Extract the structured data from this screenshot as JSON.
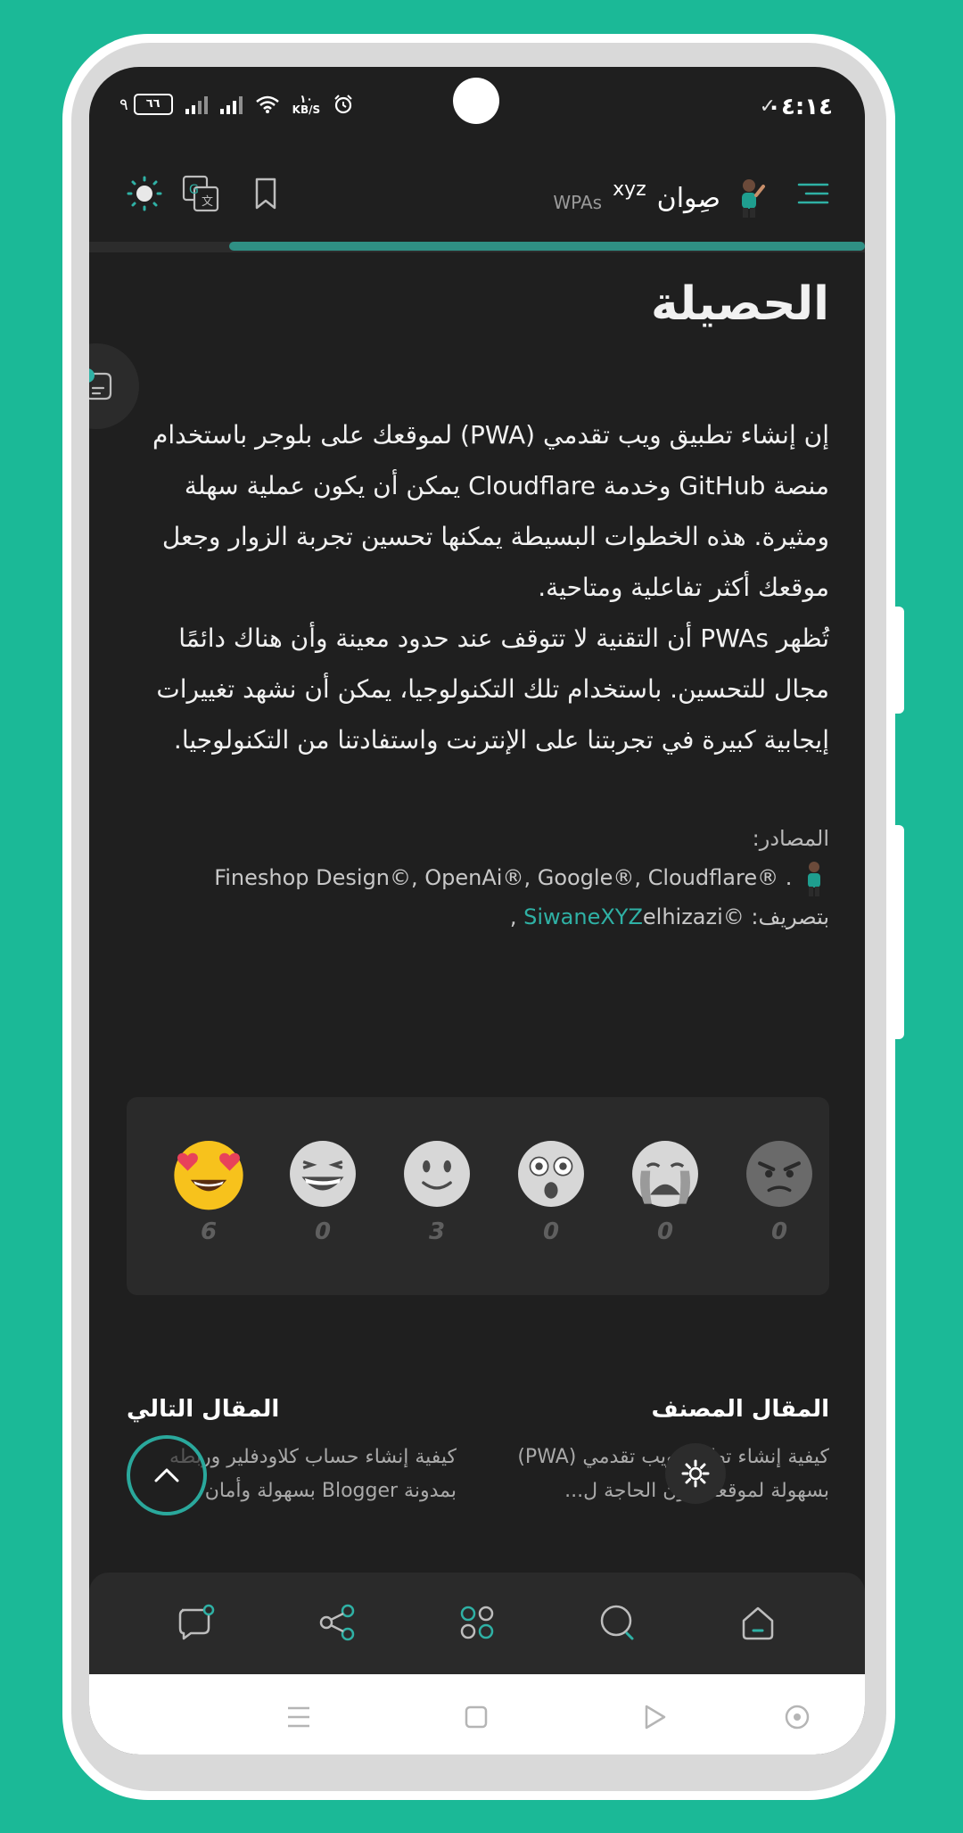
{
  "status_bar": {
    "time": "٠٤:١٤",
    "battery": "٦٦",
    "battery_prefix": "٩",
    "net_speed_value": "١٠",
    "net_speed_unit": "KB/S"
  },
  "header": {
    "brand_name": "صِوان",
    "brand_suffix": "xyz",
    "brand_tag": "WPAs"
  },
  "reading_progress": 0.82,
  "article": {
    "heading": "الحصيلة",
    "paragraph_1": "إن إنشاء تطبيق ويب تقدمي (PWA) لموقعك على بلوجر باستخدام منصة GitHub وخدمة Cloudflare يمكن أن يكون عملية سهلة ومثيرة. هذه الخطوات البسيطة يمكنها تحسين تجربة الزوار وجعل موقعك أكثر تفاعلية ومتاحية.",
    "paragraph_2": "تُظهر PWAs أن التقنية لا تتوقف عند حدود معينة وأن هناك دائمًا مجال للتحسين. باستخدام تلك التكنولوجيا، يمكن أن نشهد تغييرات إيجابية كبيرة في تجربتنا على الإنترنت واستفادتنا من التكنولوجيا.",
    "sources_label": "المصادر:",
    "sources_list": "Fineshop Design©, OpenAi®, Google®, Cloudflare® .",
    "credit_label": "بتصريف: ©",
    "credit_link": "SiwaneXYZ",
    "credit_rest": "elhizazi ,"
  },
  "reactions": [
    {
      "name": "heart-eyes",
      "count": "6"
    },
    {
      "name": "laughing",
      "count": "0"
    },
    {
      "name": "smile",
      "count": "3"
    },
    {
      "name": "surprised",
      "count": "0"
    },
    {
      "name": "crying",
      "count": "0"
    },
    {
      "name": "angry",
      "count": "0"
    }
  ],
  "post_nav": {
    "category_heading": "المقال المصنف",
    "category_text": "كيفية إنشاء تطبيق ويب تقدمي (PWA) بسهولة لموقعك دون الحاجة ل...",
    "next_heading": "المقال التالي",
    "next_text": "كيفية إنشاء حساب كلاودفلير وربطه بمدونة Blogger بسهولة وأمان"
  },
  "colors": {
    "accent": "#2fb1a5",
    "background": "#1f1f1f",
    "frame": "#1bb997"
  },
  "icons": {
    "menu": "menu-icon",
    "theme": "sun-icon",
    "translate": "translate-icon",
    "bookmark": "bookmark-icon"
  }
}
